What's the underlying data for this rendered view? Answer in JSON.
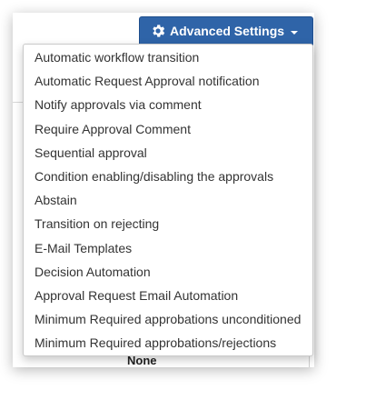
{
  "toolbar": {
    "advanced_settings_label": "Advanced Settings",
    "accent_color": "#2f64a8"
  },
  "icons": {
    "settings": "gear-icon",
    "dropdown": "caret-down-icon"
  },
  "menu": {
    "items": [
      {
        "label": "Automatic workflow transition"
      },
      {
        "label": "Automatic Request Approval notification"
      },
      {
        "label": "Notify approvals via comment"
      },
      {
        "label": "Require Approval Comment"
      },
      {
        "label": "Sequential approval"
      },
      {
        "label": "Condition enabling/disabling the approvals"
      },
      {
        "label": "Abstain"
      },
      {
        "label": "Transition on rejecting"
      },
      {
        "label": "E-Mail Templates"
      },
      {
        "label": "Decision Automation"
      },
      {
        "label": "Approval Request Email Automation"
      },
      {
        "label": "Minimum Required approbations unconditioned"
      },
      {
        "label": "Minimum Required approbations/rejections"
      }
    ]
  },
  "background": {
    "value_text": "None"
  }
}
